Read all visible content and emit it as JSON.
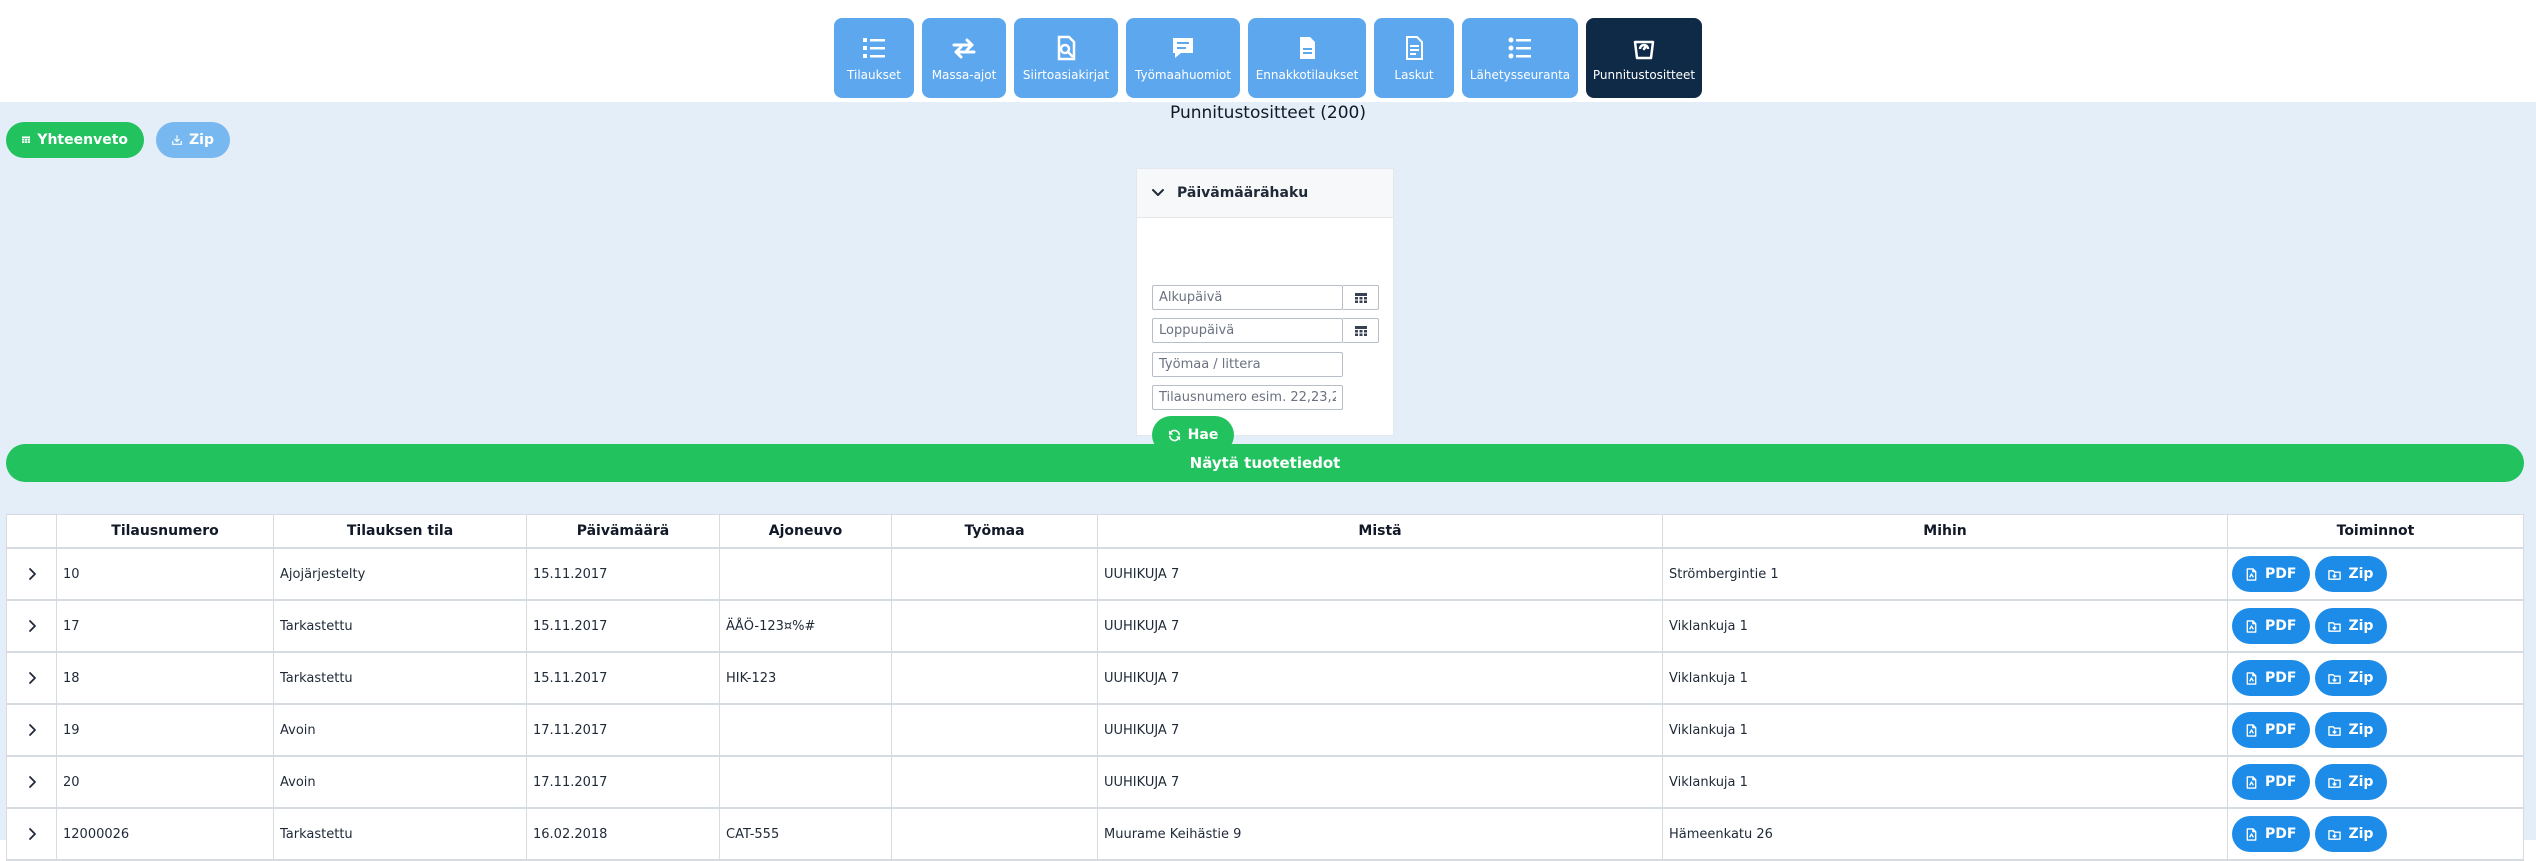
{
  "nav": {
    "items": [
      {
        "label": "Tilaukset",
        "icon": "list-ordered-icon"
      },
      {
        "label": "Massa-ajot",
        "icon": "arrows-exchange-icon"
      },
      {
        "label": "Siirtoasiakirjat",
        "icon": "file-search-icon"
      },
      {
        "label": "Työmaahuomiot",
        "icon": "comment-icon"
      },
      {
        "label": "Ennakkotilaukset",
        "icon": "file-icon"
      },
      {
        "label": "Laskut",
        "icon": "invoice-icon"
      },
      {
        "label": "Lähetysseuranta",
        "icon": "list-icon"
      },
      {
        "label": "Punnitustositteet",
        "icon": "scale-icon"
      }
    ],
    "active": "Punnitustositteet"
  },
  "page": {
    "title": "Punnitustositteet (200)"
  },
  "actions": {
    "summary_label": "Yhteenveto",
    "zip_label": "Zip"
  },
  "filter": {
    "header": "Päivämäärähaku",
    "start_date_placeholder": "Alkupäivä",
    "end_date_placeholder": "Loppupäivä",
    "site_placeholder": "Työmaa / littera",
    "order_number_placeholder": "Tilausnumero esim. 22,23,2",
    "search_label": "Hae"
  },
  "show_products_label": "Näytä tuotetiedot",
  "table": {
    "columns": [
      "Tilausnumero",
      "Tilauksen tila",
      "Päivämäärä",
      "Ajoneuvo",
      "Työmaa",
      "Mistä",
      "Mihin",
      "Toiminnot"
    ],
    "pdf_label": "PDF",
    "zip_label": "Zip",
    "rows": [
      {
        "order": "10",
        "status": "Ajojärjestelty",
        "date": "15.11.2017",
        "vehicle": "",
        "site": "",
        "from": "UUHIKUJA 7",
        "to": "Strömbergintie 1"
      },
      {
        "order": "17",
        "status": "Tarkastettu",
        "date": "15.11.2017",
        "vehicle": "ÄÅÖ-123¤%#",
        "site": "",
        "from": "UUHIKUJA 7",
        "to": "Viklankuja 1"
      },
      {
        "order": "18",
        "status": "Tarkastettu",
        "date": "15.11.2017",
        "vehicle": "HIK-123",
        "site": "",
        "from": "UUHIKUJA 7",
        "to": "Viklankuja 1"
      },
      {
        "order": "19",
        "status": "Avoin",
        "date": "17.11.2017",
        "vehicle": "",
        "site": "",
        "from": "UUHIKUJA 7",
        "to": "Viklankuja 1"
      },
      {
        "order": "20",
        "status": "Avoin",
        "date": "17.11.2017",
        "vehicle": "",
        "site": "",
        "from": "UUHIKUJA 7",
        "to": "Viklankuja 1"
      },
      {
        "order": "12000026",
        "status": "Tarkastettu",
        "date": "16.02.2018",
        "vehicle": "CAT-555",
        "site": "",
        "from": "Muurame Keihästie 9",
        "to": "Hämeenkatu 26"
      }
    ]
  },
  "colors": {
    "nav": "#5da7ee",
    "nav_active": "#0e2a47",
    "green": "#22c25e",
    "blue": "#1d8ce8",
    "background": "#e3eef8"
  }
}
